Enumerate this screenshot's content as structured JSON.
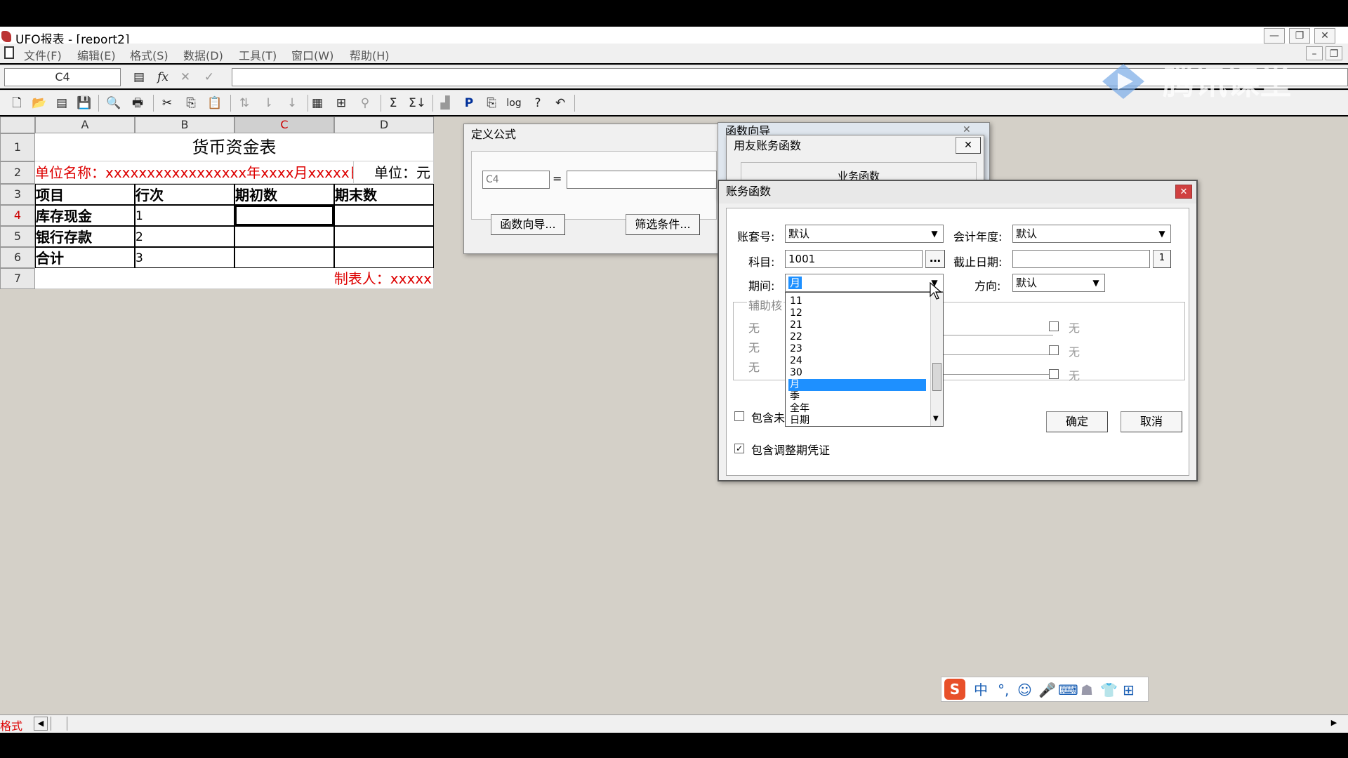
{
  "window": {
    "title": "UFO报表 - [report2]"
  },
  "menu": [
    "文件(F)",
    "编辑(E)",
    "格式(S)",
    "数据(D)",
    "工具(T)",
    "窗口(W)",
    "帮助(H)"
  ],
  "formula_bar": {
    "cell_ref": "C4",
    "fx": "fx"
  },
  "watermark": "腾讯课堂",
  "sheet": {
    "columns": [
      "A",
      "B",
      "C",
      "D"
    ],
    "rows": [
      "1",
      "2",
      "3",
      "4",
      "5",
      "6",
      "7"
    ],
    "title": "货币资金表",
    "unit_line": "单位名称：xxxxxxxxxxxxxxxxx年xxxx月xxxxx日xx",
    "unit_label": "单位：元",
    "headers": [
      "项目",
      "行次",
      "期初数",
      "期末数"
    ],
    "data_rows": [
      {
        "item": "库存现金",
        "line": "1"
      },
      {
        "item": "银行存款",
        "line": "2"
      },
      {
        "item": "合计",
        "line": "3"
      }
    ],
    "preparer": "制表人：xxxxx"
  },
  "define_formula_dialog": {
    "title": "定义公式",
    "cell_label": "C4",
    "equals": "=",
    "buttons": [
      "函数向导...",
      "筛选条件..."
    ]
  },
  "function_wizard_dialog": {
    "title": "函数向导"
  },
  "ufida_dialog": {
    "title": "用友账务函数",
    "section": "业务函数"
  },
  "account_function_dialog": {
    "title": "账务函数",
    "labels": {
      "account_set": "账套号:",
      "fiscal_year": "会计年度:",
      "subject": "科目:",
      "deadline": "截止日期:",
      "period": "期间:",
      "direction": "方向:",
      "auxiliary": "辅助核",
      "include_unposted": "包含未",
      "include_adjust": "包含调整期凭证"
    },
    "values": {
      "account_set": "默认",
      "fiscal_year": "默认",
      "subject": "1001",
      "deadline": "",
      "period": "月",
      "direction": "默认"
    },
    "aux_left": [
      "无",
      "无",
      "无"
    ],
    "aux_right": [
      "无",
      "无",
      "无"
    ],
    "period_options": [
      "11",
      "12",
      "21",
      "22",
      "23",
      "24",
      "30",
      "月",
      "季",
      "全年",
      "日期"
    ],
    "period_selected": "月",
    "include_adjust_checked": true,
    "buttons": {
      "ok": "确定",
      "cancel": "取消"
    }
  },
  "status": {
    "mode": "格式"
  },
  "colors": {
    "accent": "#1e90ff",
    "red_text": "#d00000",
    "workspace": "#d4d0c8"
  }
}
